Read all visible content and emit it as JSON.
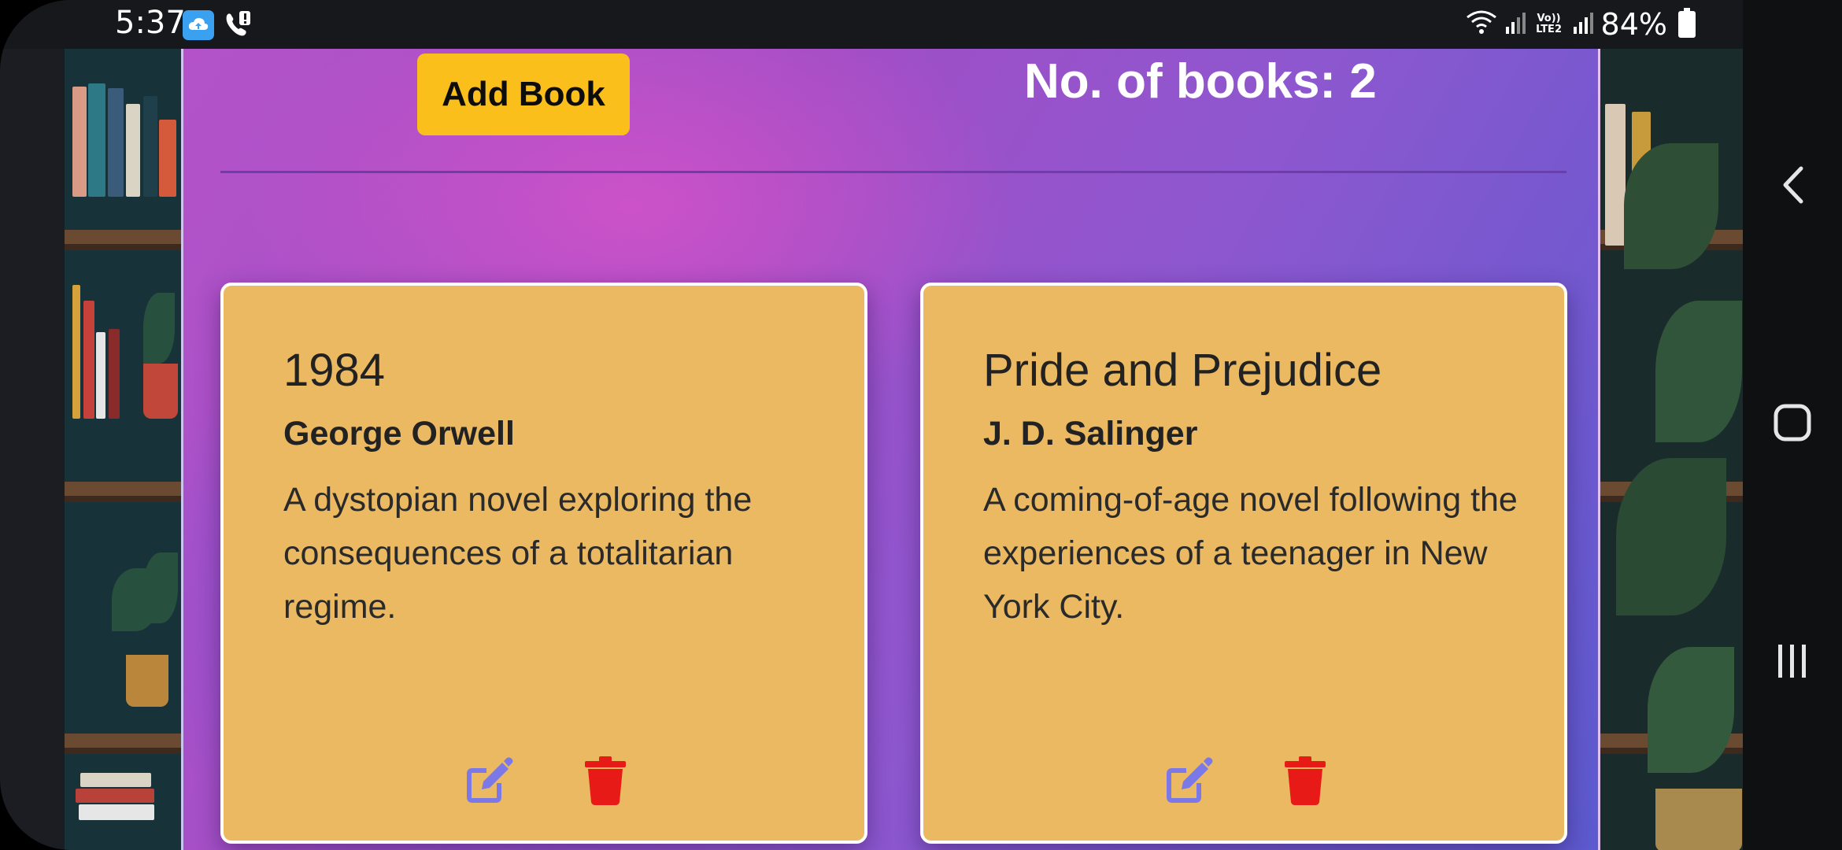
{
  "status_bar": {
    "time": "5:37",
    "network_label": "Vo)) LTE2",
    "battery": "84%"
  },
  "header": {
    "add_button_label": "Add Book",
    "book_count_label": "No. of books: 2"
  },
  "books": [
    {
      "title": "1984",
      "author": "George Orwell",
      "description": "A dystopian novel exploring the consequences of a totalitarian regime."
    },
    {
      "title": "Pride and Prejudice",
      "author": "J. D. Salinger",
      "description": "A coming-of-age novel following the experiences of a teenager in New York City."
    }
  ],
  "icons": {
    "edit": "edit-icon",
    "delete": "trash-icon",
    "back": "back-icon",
    "home": "home-icon",
    "recents": "recents-icon"
  },
  "colors": {
    "add_button": "#fbbf1b",
    "card": "#ebb962",
    "edit_icon": "#7b79e8",
    "delete_icon": "#e81a17"
  }
}
